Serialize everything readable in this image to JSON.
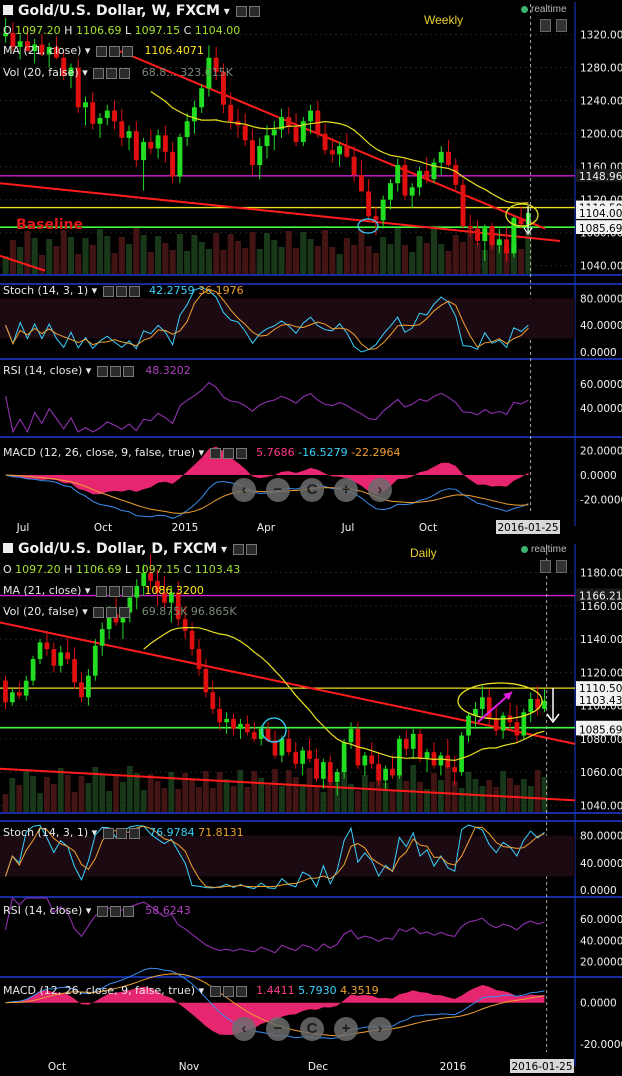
{
  "weekly": {
    "title": "Gold/U.S. Dollar, W, FXCM",
    "timeframe_label": "Weekly",
    "realtime": "realtime",
    "ohlc": {
      "o_label": "O",
      "o": "1097.20",
      "h_label": "H",
      "h": "1106.69",
      "l_label": "L",
      "l": "1097.15",
      "c_label": "C",
      "c": "1104.00"
    },
    "ma_label": "MA (21, close)",
    "ma_value": "1106.4071",
    "vol_label": "Vol (20, false)",
    "vol_values": "68.8...  323.015K",
    "baseline_label": "Baseline",
    "stoch_label": "Stoch (14, 3, 1)",
    "stoch_k": "42.2759",
    "stoch_d": "36.1976",
    "rsi_label": "RSI (14, close)",
    "rsi_value": "48.3202",
    "macd_label": "MACD (12, 26, close, 9, false, true)",
    "macd_hist": "5.7686",
    "macd_macd": "-16.5279",
    "macd_signal": "-22.2964",
    "date_flag": "2016-01-25"
  },
  "daily": {
    "title": "Gold/U.S. Dollar, D, FXCM",
    "timeframe_label": "Daily",
    "realtime": "realtime",
    "ohlc": {
      "o_label": "O",
      "o": "1097.20",
      "h_label": "H",
      "h": "1106.69",
      "l_label": "L",
      "l": "1097.15",
      "c_label": "C",
      "c": "1103.43"
    },
    "ma_label": "MA (21, close)",
    "ma_value": "1086.3200",
    "vol_label": "Vol (20, false)",
    "vol_values": "69.875K  96.865K",
    "stoch_label": "Stoch (14, 3, 1)",
    "stoch_k": "76.9784",
    "stoch_d": "71.8131",
    "rsi_label": "RSI (14, close)",
    "rsi_value": "58.6243",
    "macd_label": "MACD (12, 26, close, 9, false, true)",
    "macd_hist": "1.4411",
    "macd_macd": "5.7930",
    "macd_signal": "4.3519",
    "date_flag": "2016-01-25"
  },
  "zoom_controls": [
    "‹",
    "−",
    "C",
    "+",
    "›"
  ],
  "colors": {
    "up": "#22dd22",
    "down": "#e01010",
    "ma": "#e8e020",
    "trend": "#ff2020",
    "level": "#ff20ff",
    "support": "#40ff40",
    "stoch_k": "#3ad0ff",
    "stoch_d": "#f0a030",
    "rsi": "#9030b0",
    "macd_hist": "#ff2a7a",
    "macd_line": "#3a8ef0",
    "signal_line": "#f0a030"
  },
  "chart_data": [
    {
      "type": "candlestick",
      "title": "Gold/U.S. Dollar, W, FXCM",
      "x_ticks": [
        "Jul",
        "Oct",
        "2015",
        "Apr",
        "Jul",
        "Oct",
        "2016-01-25"
      ],
      "y_ticks": [
        "1320.00",
        "1280.00",
        "1240.00",
        "1200.00",
        "1160.00",
        "1120.00",
        "1080.00",
        "1040.00"
      ],
      "ylim": [
        1030,
        1345
      ],
      "price_tags": [
        "1148.96",
        "1110.50",
        "1104.00",
        "1086.69",
        "1085.69"
      ],
      "ma_period": 21,
      "last_close": 1104.0,
      "stoch_ticks": [
        "80.0000",
        "40.0000",
        "0.0000"
      ],
      "rsi_ticks": [
        "60.0000",
        "40.0000"
      ],
      "macd_ticks": [
        "20.0000",
        "0.0000",
        "-20.0000"
      ],
      "candles": [
        [
          1318,
          1340,
          1310,
          1322
        ],
        [
          1322,
          1335,
          1300,
          1305
        ],
        [
          1305,
          1320,
          1290,
          1312
        ],
        [
          1312,
          1330,
          1300,
          1300
        ],
        [
          1300,
          1315,
          1285,
          1308
        ],
        [
          1308,
          1320,
          1294,
          1296
        ],
        [
          1296,
          1310,
          1280,
          1305
        ],
        [
          1305,
          1318,
          1290,
          1292
        ],
        [
          1292,
          1300,
          1265,
          1270
        ],
        [
          1270,
          1285,
          1255,
          1280
        ],
        [
          1280,
          1290,
          1225,
          1232
        ],
        [
          1232,
          1245,
          1210,
          1238
        ],
        [
          1238,
          1250,
          1205,
          1212
        ],
        [
          1212,
          1225,
          1195,
          1219
        ],
        [
          1219,
          1235,
          1210,
          1228
        ],
        [
          1228,
          1240,
          1205,
          1215
        ],
        [
          1215,
          1230,
          1185,
          1195
        ],
        [
          1195,
          1210,
          1180,
          1203
        ],
        [
          1203,
          1215,
          1160,
          1168
        ],
        [
          1168,
          1195,
          1131,
          1190
        ],
        [
          1190,
          1205,
          1175,
          1182
        ],
        [
          1182,
          1205,
          1170,
          1198
        ],
        [
          1198,
          1210,
          1165,
          1178
        ],
        [
          1178,
          1190,
          1140,
          1148
        ],
        [
          1148,
          1200,
          1140,
          1196
        ],
        [
          1196,
          1225,
          1185,
          1215
        ],
        [
          1215,
          1240,
          1200,
          1232
        ],
        [
          1232,
          1260,
          1225,
          1255
        ],
        [
          1255,
          1307,
          1245,
          1292
        ],
        [
          1292,
          1305,
          1265,
          1275
        ],
        [
          1275,
          1285,
          1225,
          1235
        ],
        [
          1235,
          1250,
          1205,
          1215
        ],
        [
          1215,
          1230,
          1195,
          1210
        ],
        [
          1210,
          1225,
          1185,
          1192
        ],
        [
          1192,
          1205,
          1150,
          1162
        ],
        [
          1162,
          1195,
          1145,
          1185
        ],
        [
          1185,
          1210,
          1170,
          1198
        ],
        [
          1198,
          1215,
          1180,
          1205
        ],
        [
          1205,
          1230,
          1195,
          1220
        ],
        [
          1220,
          1232,
          1200,
          1208
        ],
        [
          1208,
          1225,
          1185,
          1190
        ],
        [
          1190,
          1220,
          1185,
          1215
        ],
        [
          1215,
          1235,
          1200,
          1228
        ],
        [
          1228,
          1240,
          1195,
          1200
        ],
        [
          1200,
          1212,
          1175,
          1180
        ],
        [
          1180,
          1195,
          1165,
          1175
        ],
        [
          1175,
          1190,
          1160,
          1185
        ],
        [
          1185,
          1200,
          1170,
          1172
        ],
        [
          1172,
          1185,
          1142,
          1150
        ],
        [
          1150,
          1168,
          1130,
          1130
        ],
        [
          1130,
          1145,
          1095,
          1100
        ],
        [
          1100,
          1112,
          1077,
          1095
        ],
        [
          1095,
          1125,
          1085,
          1120
        ],
        [
          1120,
          1145,
          1108,
          1140
        ],
        [
          1140,
          1170,
          1130,
          1162
        ],
        [
          1162,
          1170,
          1120,
          1125
        ],
        [
          1125,
          1140,
          1110,
          1135
        ],
        [
          1135,
          1160,
          1125,
          1155
        ],
        [
          1155,
          1172,
          1140,
          1145
        ],
        [
          1145,
          1170,
          1140,
          1165
        ],
        [
          1165,
          1185,
          1150,
          1178
        ],
        [
          1178,
          1192,
          1160,
          1162
        ],
        [
          1162,
          1170,
          1130,
          1138
        ],
        [
          1138,
          1145,
          1085,
          1088
        ],
        [
          1088,
          1102,
          1075,
          1085
        ],
        [
          1085,
          1095,
          1065,
          1070
        ],
        [
          1070,
          1090,
          1046,
          1088
        ],
        [
          1088,
          1092,
          1060,
          1065
        ],
        [
          1065,
          1085,
          1055,
          1072
        ],
        [
          1072,
          1086,
          1045,
          1055
        ],
        [
          1055,
          1100,
          1050,
          1098
        ],
        [
          1098,
          1112,
          1085,
          1090
        ],
        [
          1090,
          1112,
          1080,
          1104
        ]
      ]
    },
    {
      "type": "candlestick",
      "title": "Gold/U.S. Dollar, D, FXCM",
      "x_ticks": [
        "Oct",
        "Nov",
        "Dec",
        "2016",
        "2016-01-25"
      ],
      "y_ticks": [
        "1180.00",
        "1160.00",
        "1140.00",
        "1120.00",
        "1100.00",
        "1080.00",
        "1060.00",
        "1040.00"
      ],
      "ylim": [
        1036,
        1190
      ],
      "price_tags": [
        "1166.21",
        "1110.50",
        "1103.43",
        "1086.69",
        "1085.69"
      ],
      "ma_period": 21,
      "last_close": 1103.43,
      "stoch_ticks": [
        "80.0000",
        "40.0000",
        "0.0000"
      ],
      "rsi_ticks": [
        "60.0000",
        "40.0000",
        "20.0000"
      ],
      "macd_ticks": [
        "0.0000",
        "-20.0000"
      ],
      "candles": [
        [
          1115,
          1118,
          1098,
          1102
        ],
        [
          1102,
          1110,
          1100,
          1108
        ],
        [
          1108,
          1114,
          1104,
          1106
        ],
        [
          1106,
          1118,
          1103,
          1115
        ],
        [
          1115,
          1130,
          1112,
          1128
        ],
        [
          1128,
          1140,
          1125,
          1138
        ],
        [
          1138,
          1145,
          1130,
          1134
        ],
        [
          1134,
          1138,
          1120,
          1124
        ],
        [
          1124,
          1136,
          1120,
          1132
        ],
        [
          1132,
          1142,
          1125,
          1128
        ],
        [
          1128,
          1135,
          1110,
          1114
        ],
        [
          1114,
          1120,
          1102,
          1105
        ],
        [
          1105,
          1122,
          1100,
          1118
        ],
        [
          1118,
          1140,
          1115,
          1136
        ],
        [
          1136,
          1150,
          1130,
          1146
        ],
        [
          1146,
          1160,
          1140,
          1155
        ],
        [
          1155,
          1165,
          1148,
          1150
        ],
        [
          1150,
          1158,
          1140,
          1156
        ],
        [
          1156,
          1170,
          1150,
          1165
        ],
        [
          1165,
          1176,
          1158,
          1172
        ],
        [
          1172,
          1185,
          1166,
          1180
        ],
        [
          1180,
          1191,
          1170,
          1175
        ],
        [
          1175,
          1182,
          1160,
          1168
        ],
        [
          1168,
          1178,
          1158,
          1162
        ],
        [
          1162,
          1172,
          1150,
          1168
        ],
        [
          1168,
          1175,
          1148,
          1152
        ],
        [
          1152,
          1160,
          1140,
          1145
        ],
        [
          1145,
          1150,
          1130,
          1134
        ],
        [
          1134,
          1140,
          1118,
          1122
        ],
        [
          1122,
          1128,
          1105,
          1108
        ],
        [
          1108,
          1115,
          1095,
          1098
        ],
        [
          1098,
          1105,
          1085,
          1090
        ],
        [
          1090,
          1096,
          1083,
          1092
        ],
        [
          1092,
          1095,
          1082,
          1086
        ],
        [
          1086,
          1092,
          1080,
          1089
        ],
        [
          1089,
          1094,
          1082,
          1084
        ],
        [
          1084,
          1090,
          1078,
          1080
        ],
        [
          1080,
          1088,
          1076,
          1086
        ],
        [
          1086,
          1090,
          1078,
          1079
        ],
        [
          1079,
          1085,
          1068,
          1070
        ],
        [
          1070,
          1082,
          1066,
          1080
        ],
        [
          1080,
          1086,
          1070,
          1072
        ],
        [
          1072,
          1078,
          1062,
          1065
        ],
        [
          1065,
          1075,
          1058,
          1073
        ],
        [
          1073,
          1080,
          1066,
          1068
        ],
        [
          1068,
          1074,
          1054,
          1056
        ],
        [
          1056,
          1068,
          1050,
          1066
        ],
        [
          1066,
          1070,
          1052,
          1054
        ],
        [
          1054,
          1062,
          1046,
          1060
        ],
        [
          1060,
          1080,
          1056,
          1078
        ],
        [
          1078,
          1090,
          1074,
          1086
        ],
        [
          1086,
          1090,
          1062,
          1064
        ],
        [
          1064,
          1072,
          1058,
          1070
        ],
        [
          1070,
          1078,
          1062,
          1065
        ],
        [
          1065,
          1072,
          1052,
          1055
        ],
        [
          1055,
          1064,
          1050,
          1062
        ],
        [
          1062,
          1070,
          1056,
          1058
        ],
        [
          1058,
          1082,
          1056,
          1080
        ],
        [
          1080,
          1085,
          1070,
          1074
        ],
        [
          1074,
          1086,
          1068,
          1083
        ],
        [
          1083,
          1086,
          1066,
          1068
        ],
        [
          1068,
          1074,
          1060,
          1072
        ],
        [
          1072,
          1078,
          1062,
          1064
        ],
        [
          1064,
          1072,
          1058,
          1070
        ],
        [
          1070,
          1080,
          1062,
          1063
        ],
        [
          1063,
          1070,
          1052,
          1060
        ],
        [
          1060,
          1084,
          1058,
          1082
        ],
        [
          1082,
          1096,
          1078,
          1094
        ],
        [
          1094,
          1102,
          1086,
          1098
        ],
        [
          1098,
          1112,
          1092,
          1105
        ],
        [
          1105,
          1110,
          1088,
          1092
        ],
        [
          1092,
          1100,
          1082,
          1085
        ],
        [
          1085,
          1096,
          1080,
          1094
        ],
        [
          1094,
          1102,
          1086,
          1090
        ],
        [
          1090,
          1100,
          1078,
          1082
        ],
        [
          1082,
          1098,
          1080,
          1096
        ],
        [
          1096,
          1108,
          1090,
          1104
        ],
        [
          1104,
          1112,
          1094,
          1098
        ],
        [
          1098,
          1110,
          1096,
          1103
        ]
      ]
    }
  ]
}
